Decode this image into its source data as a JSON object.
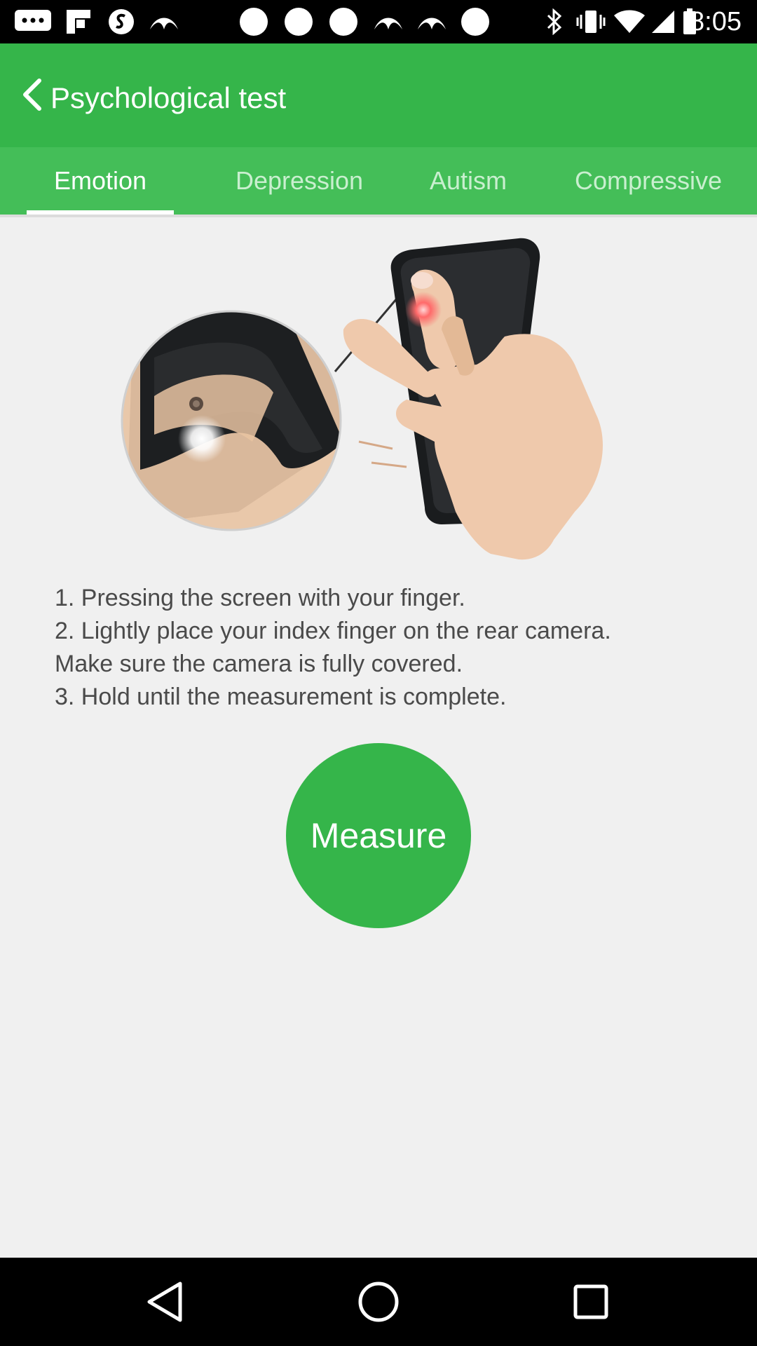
{
  "status_bar": {
    "time": "8:05",
    "left_icons": [
      "messaging-icon",
      "flipboard-icon",
      "shazam-icon",
      "bird-icon",
      "circle-icon",
      "circle-icon",
      "circle-icon",
      "bird-icon",
      "bird-icon",
      "circle-icon"
    ],
    "right_icons": [
      "bluetooth-icon",
      "vibrate-icon",
      "wifi-icon",
      "signal-icon",
      "battery-icon"
    ]
  },
  "app_bar": {
    "title": "Psychological test",
    "back_icon": "chevron-left-icon",
    "color": "#35b54a"
  },
  "tabs": [
    {
      "label": "Emotion",
      "active": true
    },
    {
      "label": "Depression",
      "active": false
    },
    {
      "label": "Autism",
      "active": false
    },
    {
      "label": "Compressive",
      "active": false
    }
  ],
  "instructions": {
    "line1": "1. Pressing the screen with your finger.",
    "line2": "2. Lightly place your index finger on the rear camera.",
    "line3": "Make sure the camera is fully covered.",
    "line4": "3. Hold until the measurement is complete."
  },
  "measure_button": {
    "label": "Measure",
    "color": "#35b54a"
  },
  "nav_bar": {
    "icons": [
      "back-triangle-icon",
      "home-circle-icon",
      "recents-square-icon"
    ]
  }
}
